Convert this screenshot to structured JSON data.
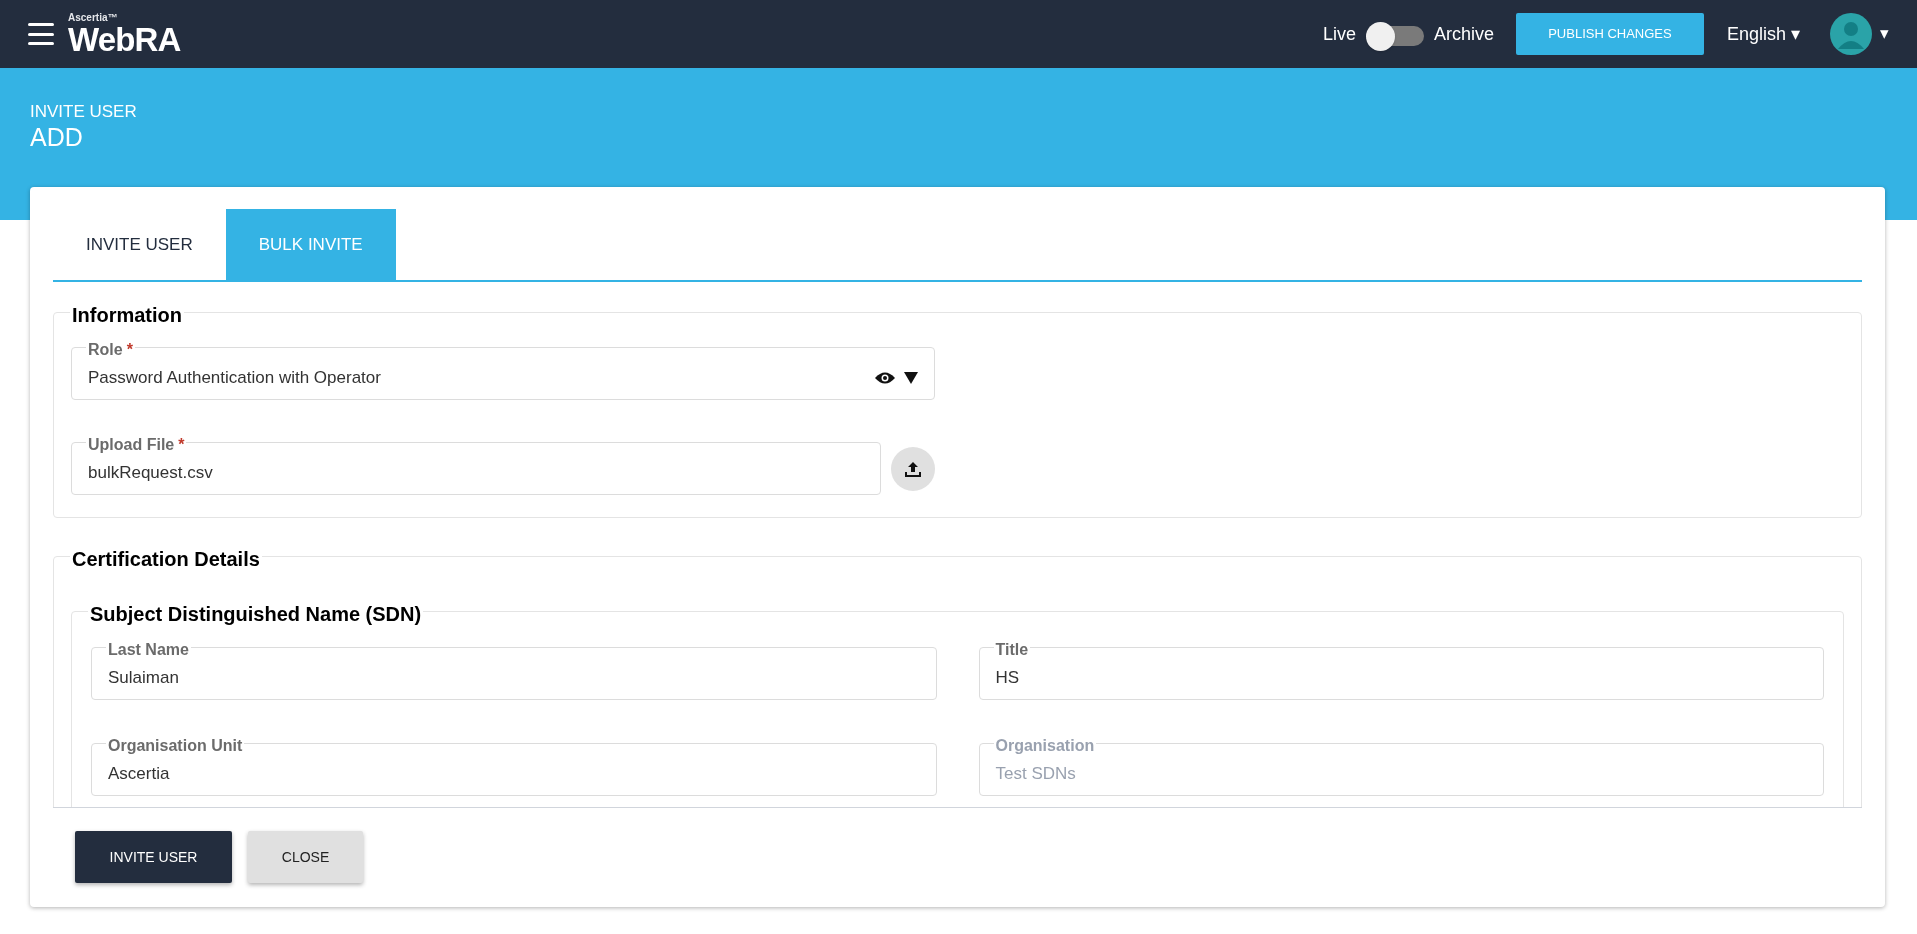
{
  "header": {
    "brand_small": "Ascertia™",
    "brand": "WebRA",
    "toggle": {
      "left_label": "Live",
      "right_label": "Archive",
      "on": false
    },
    "publish_button": "PUBLISH CHANGES",
    "language": "English ▾",
    "avatar_caret": "▾"
  },
  "page": {
    "breadcrumb": "INVITE USER",
    "title": "ADD"
  },
  "tabs": [
    {
      "label": "INVITE USER",
      "selected": false
    },
    {
      "label": "BULK INVITE",
      "selected": true
    }
  ],
  "sections": [
    {
      "title": "Information",
      "fields": [
        {
          "kind": "select",
          "label": "Role",
          "required_mark": "*",
          "value": "Password Authentication with Operator",
          "disabled": false
        },
        {
          "kind": "file",
          "label": "Upload File",
          "required_mark": "*",
          "value": "bulkRequest.csv",
          "disabled": false
        }
      ]
    },
    {
      "title": "Certification Details",
      "subsections": [
        {
          "title": "Subject Distinguished Name (SDN)",
          "fields": [
            {
              "kind": "text",
              "label": "Last Name",
              "value": "Sulaiman",
              "disabled": false
            },
            {
              "kind": "text",
              "label": "Title",
              "value": "HS",
              "disabled": false
            },
            {
              "kind": "text",
              "label": "Organisation Unit",
              "value": "Ascertia",
              "disabled": false
            },
            {
              "kind": "text",
              "label": "Organisation",
              "value": "Test SDNs",
              "disabled": true
            }
          ]
        }
      ]
    }
  ],
  "footer_buttons": [
    {
      "label": "INVITE USER",
      "kind": "primary"
    },
    {
      "label": "CLOSE",
      "kind": "secondary"
    }
  ]
}
